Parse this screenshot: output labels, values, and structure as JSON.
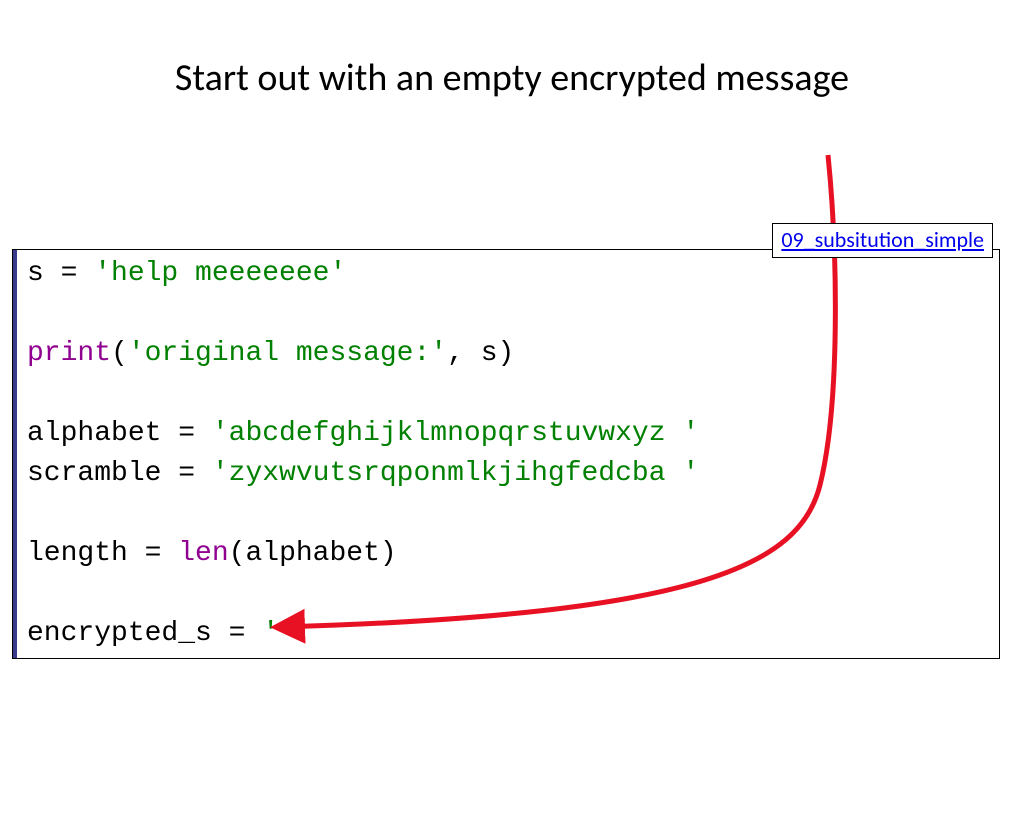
{
  "title": "Start out with an empty encrypted message",
  "link_label": "09_subsitution_simple",
  "code": {
    "line1_var": "s = ",
    "line1_str": "'help meeeeeee'",
    "line3_fn": "print",
    "line3_open": "(",
    "line3_str": "'original message:'",
    "line3_rest": ", s)",
    "line5_var": "alphabet = ",
    "line5_str": "'abcdefghijklmnopqrstuvwxyz '",
    "line6_var": "scramble = ",
    "line6_str": "'zyxwvutsrqponmlkjihgfedcba '",
    "line8_a": "length = ",
    "line8_fn": "len",
    "line8_b": "(alphabet)",
    "line10_a": "encrypted_s = ",
    "line10_str": "''"
  }
}
